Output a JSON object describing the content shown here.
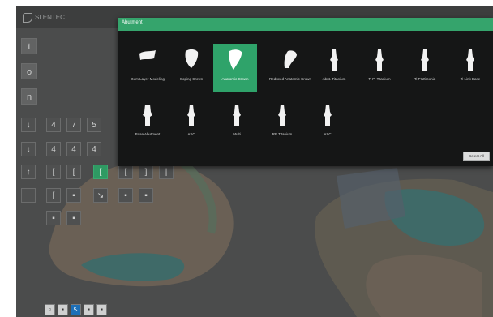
{
  "app": {
    "logo_text": "SLENTEC"
  },
  "colors": {
    "accent": "#35a46c",
    "selected": "#2fa36a",
    "panel": "#151616"
  },
  "panel": {
    "title": "Abutment",
    "button_label": "Select All",
    "items": [
      {
        "label": "Gum Layer Modeling",
        "icon": "gum-layer-icon"
      },
      {
        "label": "Coping Crown",
        "icon": "coping-crown-icon"
      },
      {
        "label": "Anatomic Crown",
        "icon": "anatomic-crown-icon",
        "selected": true
      },
      {
        "label": "Reduced Anatomic Crown",
        "icon": "reduced-crown-icon"
      },
      {
        "label": "Abut. Titanium",
        "icon": "titanium-abutment-icon"
      },
      {
        "label": "Ti PI Titanium",
        "icon": "ti-pi-titanium-icon"
      },
      {
        "label": "Ti PI Zirconia",
        "icon": "ti-pi-zirconia-icon"
      },
      {
        "label": "Ti Link Base",
        "icon": "ti-link-base-icon"
      },
      {
        "label": "Base Abutment",
        "icon": "base-abutment-icon"
      },
      {
        "label": "ASC",
        "icon": "asc-abutment-icon"
      },
      {
        "label": "Multi",
        "icon": "multi-abutment-icon"
      },
      {
        "label": "RE Titanium",
        "icon": "re-titanium-icon"
      },
      {
        "label": "ASC",
        "icon": "asc-abutment-2-icon"
      }
    ]
  },
  "toolbar": {
    "main_icons": [
      "t",
      "o",
      "n"
    ],
    "rows": [
      {
        "lead": "↓",
        "cells": [
          "4",
          "7",
          "5"
        ]
      },
      {
        "lead": "↕",
        "cells": [
          "4",
          "4",
          "4"
        ]
      },
      {
        "lead": "↑",
        "cells": [
          "[",
          "[",
          "[",
          "[",
          "]",
          "|"
        ]
      },
      {
        "lead": "",
        "cells": [
          "[",
          "▪",
          "↘",
          "▪",
          "▪"
        ]
      },
      {
        "lead": "",
        "cells": [
          "▪",
          "▪"
        ]
      }
    ],
    "bottom_icons": [
      "▫",
      "▪",
      "↖",
      "▪",
      "▪"
    ]
  }
}
